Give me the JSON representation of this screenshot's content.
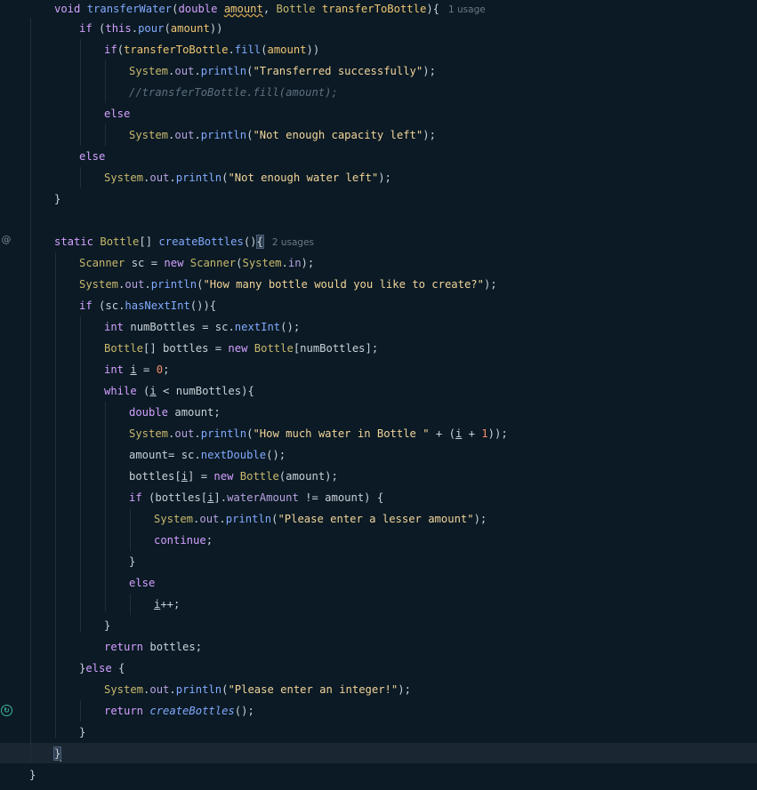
{
  "gutter": {
    "override_marker": "@",
    "recursion_marker": "↻"
  },
  "hints": {
    "transfer_usages": "1 usage",
    "create_usages": "2 usages"
  },
  "code": {
    "l1": {
      "kw": "void",
      "fn": "transferWater",
      "p1type": "double",
      "p1": "amount",
      "p2type": "Bottle",
      "p2": "transferToBottle",
      "open": "){"
    },
    "l2": {
      "kw": "if",
      "text1": " (",
      "this": "this",
      "dot": ".",
      "fn": "pour",
      "arg": "amount",
      "close": "))"
    },
    "l3": {
      "kw": "if",
      "obj": "transferToBottle",
      "fn": "fill",
      "arg": "amount",
      "close": "))"
    },
    "l4": {
      "sys": "System",
      "out": "out",
      "fn": "println",
      "str": "\"Transferred successfully\"",
      "end": ");"
    },
    "l5": {
      "cmt": "//transferToBottle.fill(amount);"
    },
    "l6": {
      "kw": "else"
    },
    "l7": {
      "sys": "System",
      "out": "out",
      "fn": "println",
      "str": "\"Not enough capacity left\"",
      "end": ");"
    },
    "l8": {
      "kw": "else"
    },
    "l9": {
      "sys": "System",
      "out": "out",
      "fn": "println",
      "str": "\"Not enough water left\"",
      "end": ");"
    },
    "l10": {
      "text": "}"
    },
    "l12": {
      "kw": "static",
      "type": "Bottle",
      "brackets": "[] ",
      "fn": "createBottles",
      "parens": "()",
      "brace": "{"
    },
    "l13": {
      "type": "Scanner",
      "var": " sc = ",
      "kw": "new",
      "cls": "Scanner",
      "open": "(",
      "sys": "System",
      "in": "in",
      "end": ");"
    },
    "l14": {
      "sys": "System",
      "out": "out",
      "fn": "println",
      "str": "\"How many bottle would you like to create?\"",
      "end": ");"
    },
    "l15": {
      "kw": "if",
      "open": " (",
      "obj": "sc",
      "fn": "hasNextInt",
      "end": "()){"
    },
    "l16": {
      "kw": "int",
      "var": " numBottles = ",
      "obj": "sc",
      "fn": "nextInt",
      "end": "();"
    },
    "l17": {
      "type": "Bottle",
      "var": "[] bottles = ",
      "kw": "new",
      "cls": "Bottle",
      "arg": "[numBottles];"
    },
    "l18": {
      "kw": "int",
      "i": "i",
      "eq": " = ",
      "num": "0",
      "end": ";"
    },
    "l19": {
      "kw": "while",
      "open": " (",
      "i": "i",
      "rest": " < numBottles){"
    },
    "l20": {
      "kw": "double",
      "var": " amount;"
    },
    "l21": {
      "sys": "System",
      "out": "out",
      "fn": "println",
      "str": "\"How much water in Bottle \"",
      "plus": " + (",
      "i": "i",
      "plus2": " + ",
      "num": "1",
      "end": "));"
    },
    "l22": {
      "var": "amount= ",
      "obj": "sc",
      "fn": "nextDouble",
      "end": "();"
    },
    "l23": {
      "var": "bottles[",
      "i": "i",
      "mid": "] = ",
      "kw": "new",
      "cls": "Bottle",
      "end": "(amount);"
    },
    "l24": {
      "kw": "if",
      "open": " (bottles[",
      "i": "i",
      "mid": "].",
      "field": "waterAmount",
      "end": " != amount) {"
    },
    "l25": {
      "sys": "System",
      "out": "out",
      "fn": "println",
      "str": "\"Please enter a lesser amount\"",
      "end": ");"
    },
    "l26": {
      "kw": "continue",
      "end": ";"
    },
    "l27": {
      "text": "}"
    },
    "l28": {
      "kw": "else"
    },
    "l29": {
      "i": "i",
      "end": "++;"
    },
    "l30": {
      "text": "}"
    },
    "l31": {
      "kw": "return",
      "var": " bottles;"
    },
    "l32": {
      "brace": "}",
      "kw": "else",
      "end": " {"
    },
    "l33": {
      "sys": "System",
      "out": "out",
      "fn": "println",
      "str": "\"Please enter an integer!\"",
      "end": ");"
    },
    "l34": {
      "kw": "return",
      "fn": "createBottles",
      "end": "();"
    },
    "l35": {
      "text": "}"
    },
    "l36": {
      "text": "}"
    },
    "l37": {
      "text": "}"
    }
  }
}
